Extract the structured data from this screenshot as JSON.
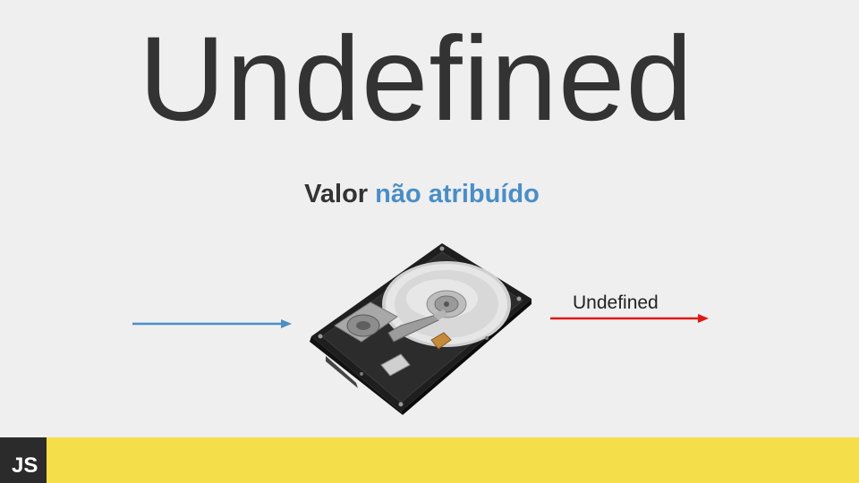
{
  "slide": {
    "title": "Undefined",
    "subtitle_part1": "Valor ",
    "subtitle_part2": "não atribuído",
    "output_label": "Undefined",
    "footer_badge": "JS"
  },
  "colors": {
    "background": "#efefef",
    "title": "#333333",
    "accent_blue": "#4a8ec7",
    "arrow_in": "#4a8ec7",
    "arrow_out": "#e01818",
    "footer_bar": "#f4de4a",
    "badge": "#2b2b2b"
  },
  "icons": {
    "image": "hard-disk-drive",
    "arrow_in": "arrow-right-icon",
    "arrow_out": "arrow-right-icon"
  }
}
